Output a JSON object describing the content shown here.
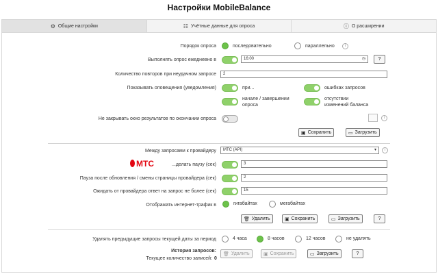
{
  "app": {
    "title": "Настройки MobileBalance"
  },
  "tabs": [
    {
      "label": "Общие настройки",
      "icon": "gear-icon",
      "glyph": "⚙"
    },
    {
      "label": "Учётные данные для опроса",
      "icon": "list-icon",
      "glyph": "☷"
    },
    {
      "label": "О расширении",
      "icon": "info-icon",
      "glyph": "ⓘ"
    }
  ],
  "general": {
    "order_label": "Порядок опроса",
    "order_sequential": "последовательно",
    "order_parallel": "параллельно",
    "daily_label": "Выполнять опрос ежедневно в",
    "daily_time": "16:00",
    "retry_label": "Количество повторов при неудачном запросе",
    "retry_value": "2",
    "notify_label": "Показывать оповещения (уведомления)",
    "notify_on": "при...",
    "notify_errors": "ошибках запросов",
    "notify_start_end": "начале / завершении опроса",
    "notify_no_change": "отсутствии изменений баланса",
    "keep_window_label": "Не закрывать окно результатов по окончании опроса",
    "save_label": "Сохранить",
    "load_label": "Загрузить"
  },
  "provider": {
    "between_label": "Между запросами к провайдеру",
    "selected": "МТС (API)",
    "pause_label": "...делать паузу (сек)",
    "pause_value": "3",
    "page_pause_label": "Пауза после обновления / смены страницы провайдера (сек)",
    "page_pause_value": "2",
    "wait_label": "Ожидать от провайдера ответ на запрос не более (сек)",
    "wait_value": "15",
    "traffic_label": "Отображать интернет-трафик в",
    "traffic_gb": "гигабайтах",
    "traffic_mb": "мегабайтах",
    "delete_label": "Удалить",
    "save_label": "Сохранить",
    "load_label": "Загрузить",
    "logo_text": "МТС"
  },
  "history": {
    "delete_prev_label": "Удалять предыдущие запросы текущей даты за период",
    "opt_4h": "4 часа",
    "opt_8h": "8 часов",
    "opt_12h": "12 часов",
    "opt_none": "не удалять",
    "title": "История запросов:",
    "count_label": "Текущее количество записей:",
    "count_value": "0",
    "delete_label": "Удалить",
    "save_label": "Сохранить",
    "load_label": "Загрузить"
  },
  "help_glyph": "?",
  "colors": {
    "toggle_on": "#8fd16a",
    "radio_on": "#6cc24a",
    "mts_red": "#e30611"
  }
}
